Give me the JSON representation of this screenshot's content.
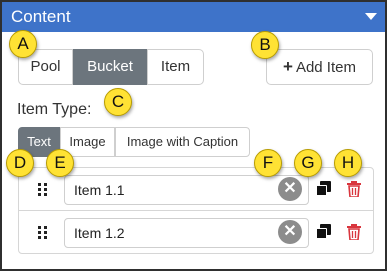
{
  "panel": {
    "title": "Content"
  },
  "mode_buttons": [
    {
      "label": "Pool",
      "active": false
    },
    {
      "label": "Bucket",
      "active": true
    },
    {
      "label": "Item",
      "active": false
    }
  ],
  "add_item": {
    "icon": "plus-icon",
    "plus": "+",
    "label": "Add Item"
  },
  "item_type": {
    "label": "Item Type:",
    "tabs": [
      {
        "label": "Text",
        "active": true
      },
      {
        "label": "Image",
        "active": false
      },
      {
        "label": "Image with Caption",
        "active": false
      }
    ]
  },
  "items": [
    {
      "value": "Item 1.1"
    },
    {
      "value": "Item 1.2"
    }
  ],
  "row_icons": {
    "drag": "drag-handle-icon",
    "clear": "clear-circle-icon",
    "clear_glyph": "✕",
    "copy": "copy-icon",
    "delete": "trash-icon"
  },
  "callouts": {
    "a": "A",
    "b": "B",
    "c": "C",
    "d": "D",
    "e": "E",
    "f": "F",
    "g": "G",
    "h": "H"
  },
  "colors": {
    "header_bg": "#3e73c9",
    "active_button_bg": "#6c757d",
    "delete_red": "#d9363e",
    "callout_yellow": "#ffe234"
  }
}
